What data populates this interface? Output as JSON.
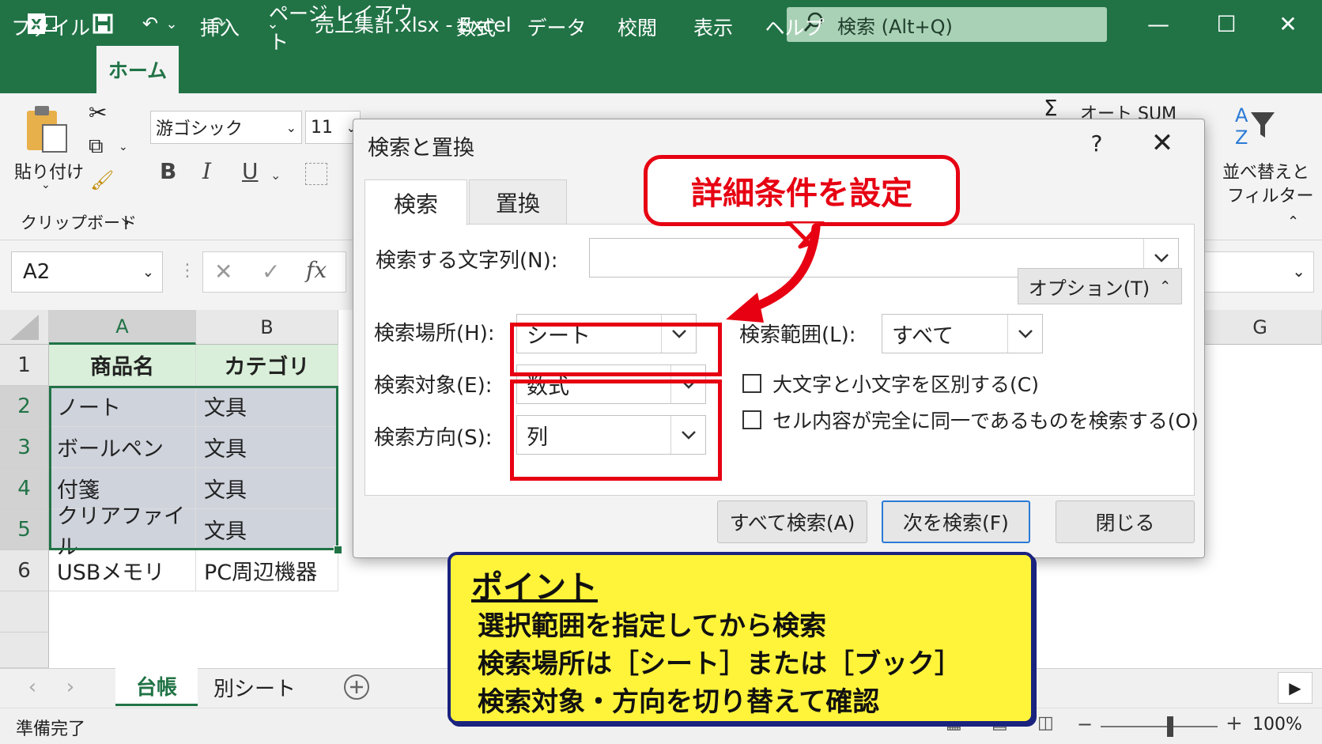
{
  "window": {
    "title": "売上集計.xlsx  -  Excel",
    "search_placeholder": "検索 (Alt+Q)",
    "controls": {
      "minimize": "—",
      "maximize": "☐",
      "close": "✕"
    },
    "quick_access": {
      "undo_arrow": "⌄",
      "customize": "⌄"
    }
  },
  "ribbon": {
    "tabs": [
      "ファイル",
      "ホーム",
      "挿入",
      "ページ レイアウト",
      "数式",
      "データ",
      "校閲",
      "表示",
      "ヘルプ"
    ],
    "active_tab": "ホーム",
    "paste_label": "貼り付け",
    "clipboard_group": "クリップボード",
    "font_name": "游ゴシック",
    "font_size": "11",
    "bold": "B",
    "italic": "I",
    "underline": "U",
    "autosum": "オート SUM",
    "sort_filter_line1": "並べ替えと",
    "sort_filter_line2": "フィルター"
  },
  "formula_bar": {
    "name_box": "A2",
    "fx": "fx"
  },
  "sheet": {
    "columns": [
      "A",
      "B",
      "G"
    ],
    "rows": [
      {
        "num": "1",
        "a": "商品名",
        "b": "カテゴリ"
      },
      {
        "num": "2",
        "a": "ノート",
        "b": "文具"
      },
      {
        "num": "3",
        "a": "ボールペン",
        "b": "文具"
      },
      {
        "num": "4",
        "a": "付箋",
        "b": "文具"
      },
      {
        "num": "5",
        "a": "クリアファイル",
        "b": "文具"
      },
      {
        "num": "6",
        "a": "USBメモリ",
        "b": "PC周辺機器"
      }
    ],
    "tabs": [
      "台帳",
      "別シート"
    ],
    "active_tab": "台帳"
  },
  "status": {
    "ready": "準備完了",
    "zoom": "100%"
  },
  "dialog": {
    "title": "検索と置換",
    "help": "?",
    "close": "✕",
    "tabs": [
      "検索",
      "置換"
    ],
    "find_label": "検索する文字列(N):",
    "find_value": "",
    "options_button": "オプション(T)",
    "within_label": "検索場所(H):",
    "within_value": "シート",
    "scope_label": "検索範囲(L):",
    "scope_value": "すべて",
    "lookin_label": "検索対象(E):",
    "lookin_value": "数式",
    "direction_label": "検索方向(S):",
    "direction_value": "列",
    "match_case": "大文字と小文字を区別する(C)",
    "match_entire": "セル内容が完全に同一であるものを検索する(O)",
    "find_all": "すべて検索(A)",
    "find_next": "次を検索(F)",
    "close_button": "閉じる"
  },
  "annotation": {
    "callout": "詳細条件を設定",
    "accent_color": "#e60012"
  },
  "point": {
    "title": "ポイント",
    "lines": [
      "選択範囲を指定してから検索",
      "検索場所は［シート］または［ブック］",
      "検索対象・方向を切り替えて確認"
    ]
  }
}
